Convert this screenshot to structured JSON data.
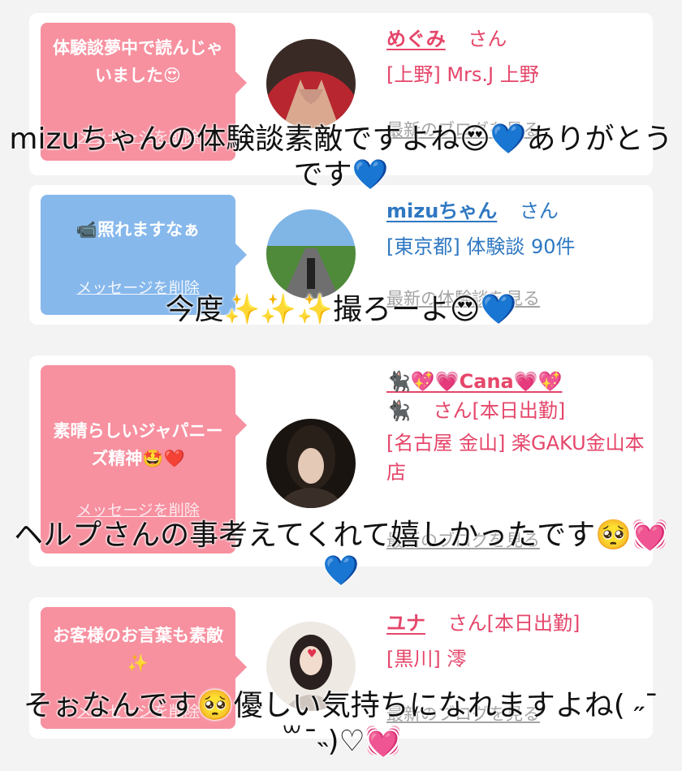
{
  "cards": [
    {
      "bubble": "体験談夢中で読んじゃいました😍",
      "delete_label": "メッセージを削除",
      "name": "めぐみ",
      "honorific": "さん",
      "status": "",
      "shop": "[上野] Mrs.J 上野",
      "link": "最新のブログを見る"
    },
    {
      "bubble": "📹照れますなぁ",
      "delete_label": "メッセージを削除",
      "name": "mizuちゃん",
      "honorific": "さん",
      "status": "",
      "shop": "[東京都] 体験談 90件",
      "link": "最新の体験談を見る"
    },
    {
      "bubble": "素晴らしいジャパニーズ精神🤩❤️",
      "delete_label": "メッセージを削除",
      "name": "🐈‍⬛💖💗Cana💗💖",
      "name2": "🐈‍⬛",
      "honorific": "さん",
      "status": "[本日出勤]",
      "shop": "[名古屋 金山] 楽GAKU金山本店",
      "link": "最新のブログを見る"
    },
    {
      "bubble": "お客様のお言葉も素敵✨",
      "delete_label": "メッセージを削除",
      "name": "ユナ",
      "honorific": "さん",
      "status": "[本日出勤]",
      "shop": "[黒川] 澪",
      "link": "最新のブログを見る"
    }
  ],
  "captions": [
    "mizuちゃんの体験談素敵ですよね😍💙ありがとうです💙",
    "今度✨✨✨撮ろーよ😍💙",
    "ヘルプさんの事考えてくれて嬉しかったです🥺💓💙",
    "そぉなんです🥺優しい気持ちになれますよね( ˶¯ ꒳¯˵)♡💓"
  ],
  "colors": {
    "pink_bubble": "#f7909f",
    "blue_bubble": "#86b8ec",
    "pink_text": "#e5466a",
    "blue_text": "#2f78c2"
  }
}
